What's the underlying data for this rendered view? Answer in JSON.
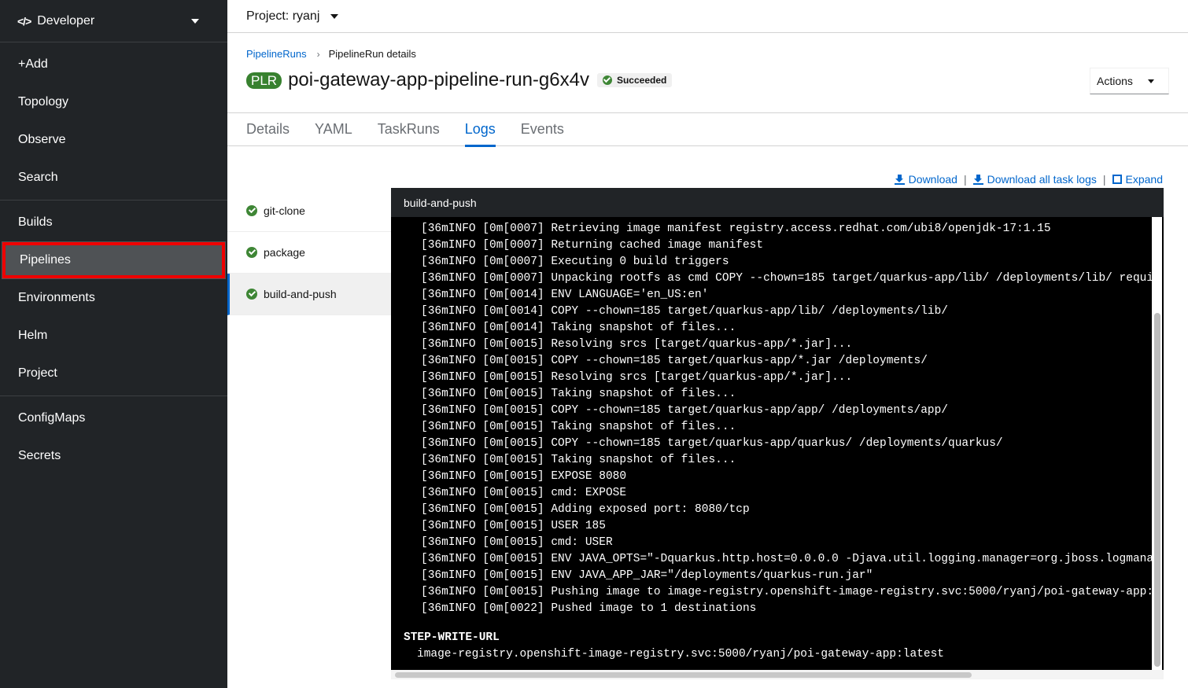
{
  "sidebar": {
    "perspective": "Developer",
    "groups": [
      [
        "+Add",
        "Topology",
        "Observe",
        "Search"
      ],
      [
        "Builds",
        "Pipelines",
        "Environments",
        "Helm",
        "Project"
      ],
      [
        "ConfigMaps",
        "Secrets"
      ]
    ],
    "active": "Pipelines"
  },
  "project": {
    "label": "Project: ryanj"
  },
  "breadcrumb": {
    "parent": "PipelineRuns",
    "current": "PipelineRun details"
  },
  "header": {
    "badge": "PLR",
    "title": "poi-gateway-app-pipeline-run-g6x4v",
    "status": "Succeeded",
    "actions": "Actions"
  },
  "tabs": [
    "Details",
    "YAML",
    "TaskRuns",
    "Logs",
    "Events"
  ],
  "active_tab": "Logs",
  "log_links": {
    "download": "Download",
    "download_all": "Download all task logs",
    "expand": "Expand"
  },
  "tasks": [
    "git-clone",
    "package",
    "build-and-push"
  ],
  "active_task": "build-and-push",
  "log": {
    "header": "build-and-push",
    "lines": [
      "[36mINFO [0m[0007] Retrieving image manifest registry.access.redhat.com/ubi8/openjdk-17:1.15",
      "[36mINFO [0m[0007] Returning cached image manifest",
      "[36mINFO [0m[0007] Executing 0 build triggers",
      "[36mINFO [0m[0007] Unpacking rootfs as cmd COPY --chown=185 target/quarkus-app/lib/ /deployments/lib/ requires",
      "[36mINFO [0m[0014] ENV LANGUAGE='en_US:en'",
      "[36mINFO [0m[0014] COPY --chown=185 target/quarkus-app/lib/ /deployments/lib/",
      "[36mINFO [0m[0014] Taking snapshot of files...",
      "[36mINFO [0m[0015] Resolving srcs [target/quarkus-app/*.jar]...",
      "[36mINFO [0m[0015] COPY --chown=185 target/quarkus-app/*.jar /deployments/",
      "[36mINFO [0m[0015] Resolving srcs [target/quarkus-app/*.jar]...",
      "[36mINFO [0m[0015] Taking snapshot of files...",
      "[36mINFO [0m[0015] COPY --chown=185 target/quarkus-app/app/ /deployments/app/",
      "[36mINFO [0m[0015] Taking snapshot of files...",
      "[36mINFO [0m[0015] COPY --chown=185 target/quarkus-app/quarkus/ /deployments/quarkus/",
      "[36mINFO [0m[0015] Taking snapshot of files...",
      "[36mINFO [0m[0015] EXPOSE 8080",
      "[36mINFO [0m[0015] cmd: EXPOSE",
      "[36mINFO [0m[0015] Adding exposed port: 8080/tcp",
      "[36mINFO [0m[0015] USER 185",
      "[36mINFO [0m[0015] cmd: USER",
      "[36mINFO [0m[0015] ENV JAVA_OPTS=\"-Dquarkus.http.host=0.0.0.0 -Djava.util.logging.manager=org.jboss.logmanager.",
      "[36mINFO [0m[0015] ENV JAVA_APP_JAR=\"/deployments/quarkus-run.jar\"",
      "[36mINFO [0m[0015] Pushing image to image-registry.openshift-image-registry.svc:5000/ryanj/poi-gateway-app:late",
      "[36mINFO [0m[0022] Pushed image to 1 destinations"
    ],
    "step_title": "STEP-WRITE-URL",
    "step_value": "image-registry.openshift-image-registry.svc:5000/ryanj/poi-gateway-app:latest"
  }
}
